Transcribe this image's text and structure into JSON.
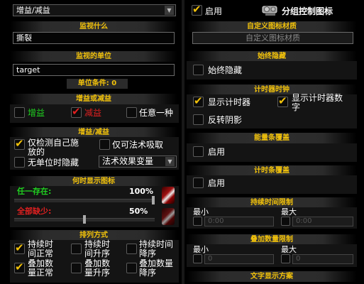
{
  "left": {
    "type_dropdown": {
      "value": "增益/减益"
    },
    "monitor": {
      "header": "监视什么",
      "value": "撕裂"
    },
    "unit": {
      "header": "监视的单位",
      "value": "target",
      "condition_label": "单位条件:",
      "condition_value": "0"
    },
    "buff_debuff": {
      "header": "增益或减益",
      "options": [
        {
          "label": "增益",
          "checked": false,
          "color": "#20d020"
        },
        {
          "label": "减益",
          "checked": true,
          "color": "#e02020"
        },
        {
          "label": "任意一种",
          "checked": false,
          "color": "#ffffff"
        }
      ]
    },
    "buff_debuff_opts": {
      "header": "增益/减益",
      "only_self_line1": "仅检测自己施",
      "only_self_line2": "放的",
      "only_absorb": "仅可法术吸取",
      "hide_no_unit": "无单位时隐藏",
      "effect_dropdown": "法术效果变量"
    },
    "when_show": {
      "header": "何时显示图标",
      "any_present": "任一存在:",
      "any_present_pct": "100%",
      "any_present_value": 1.0,
      "all_missing": "全部缺少:",
      "all_missing_pct": "50%",
      "all_missing_value": 0.5
    },
    "sort": {
      "header": "排列方式",
      "items": [
        {
          "line1": "持续时",
          "line2": "间正常",
          "checked": true
        },
        {
          "line1": "持续时",
          "line2": "间升序",
          "checked": false
        },
        {
          "line1": "持续时间",
          "line2": "降序",
          "checked": false
        },
        {
          "line1": "叠加数",
          "line2": "量正常",
          "checked": true
        },
        {
          "line1": "叠加数",
          "line2": "量升序",
          "checked": false
        },
        {
          "line1": "叠加数量",
          "line2": "降序",
          "checked": false
        }
      ]
    }
  },
  "right": {
    "enable_label": "启用",
    "group_control_label": "分组控制图标",
    "custom_texture": {
      "header": "自定义图标材质",
      "placeholder": "自定义图标材质"
    },
    "always_hide": {
      "header": "始终隐藏",
      "label": "始终隐藏"
    },
    "timer_clock": {
      "header": "计时器时钟",
      "show_timer": "显示计时器",
      "show_timer_num_line1": "显示计时器数",
      "show_timer_num_line2": "字",
      "reverse_shadow": "反转阴影"
    },
    "power_overlay": {
      "header": "能量条覆盖",
      "label": "启用"
    },
    "timer_overlay": {
      "header": "计时条覆盖",
      "label": "启用"
    },
    "duration_limit": {
      "header": "持续时间限制",
      "min_label": "最小",
      "max_label": "最大",
      "min_value": "0:00",
      "max_value": "0:00"
    },
    "stack_limit": {
      "header": "叠加数量限制",
      "min_label": "最小",
      "max_label": "最大",
      "min_value": "0",
      "max_value": "0"
    },
    "text_scheme": {
      "header": "文字显示方案"
    }
  },
  "colors": {
    "accent": "#f2c20b",
    "green": "#20d020",
    "red": "#e02020"
  }
}
